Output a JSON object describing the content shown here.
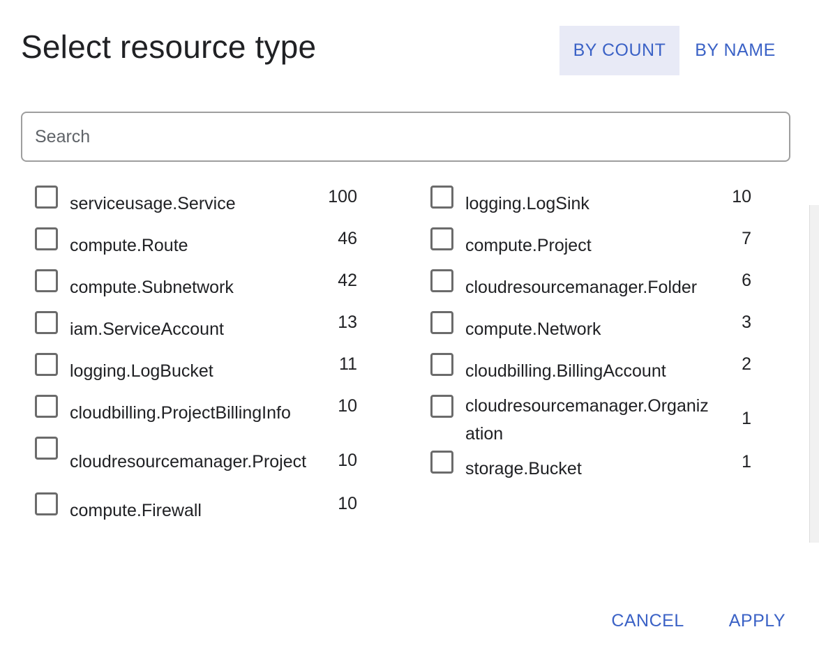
{
  "dialog": {
    "title": "Select resource type",
    "sort": {
      "by_count": "BY COUNT",
      "by_name": "BY NAME",
      "active": "by_count"
    },
    "search": {
      "placeholder": "Search",
      "value": ""
    },
    "left_items": [
      {
        "label": "serviceusage.Service",
        "count": "100",
        "checked": false
      },
      {
        "label": "compute.Route",
        "count": "46",
        "checked": false
      },
      {
        "label": "compute.Subnetwork",
        "count": "42",
        "checked": false
      },
      {
        "label": "iam.ServiceAccount",
        "count": "13",
        "checked": false
      },
      {
        "label": "logging.LogBucket",
        "count": "11",
        "checked": false
      },
      {
        "label": "cloudbilling.ProjectBillingInfo",
        "count": "10",
        "checked": false
      },
      {
        "label": "cloudresourcemanager.Project",
        "count": "10",
        "checked": false
      },
      {
        "label": "compute.Firewall",
        "count": "10",
        "checked": false
      }
    ],
    "right_items": [
      {
        "label": "logging.LogSink",
        "count": "10",
        "checked": false
      },
      {
        "label": "compute.Project",
        "count": "7",
        "checked": false
      },
      {
        "label": "cloudresourcemanager.Folder",
        "count": "6",
        "checked": false
      },
      {
        "label": "compute.Network",
        "count": "3",
        "checked": false
      },
      {
        "label": "cloudbilling.BillingAccount",
        "count": "2",
        "checked": false
      },
      {
        "label": "cloudresourcemanager.Organization",
        "count": "1",
        "checked": false
      },
      {
        "label": "storage.Bucket",
        "count": "1",
        "checked": false
      }
    ],
    "actions": {
      "cancel": "CANCEL",
      "apply": "APPLY"
    },
    "colors": {
      "accent": "#3b62c6",
      "active_tab_bg": "#e8eaf6",
      "text": "#202124"
    }
  }
}
